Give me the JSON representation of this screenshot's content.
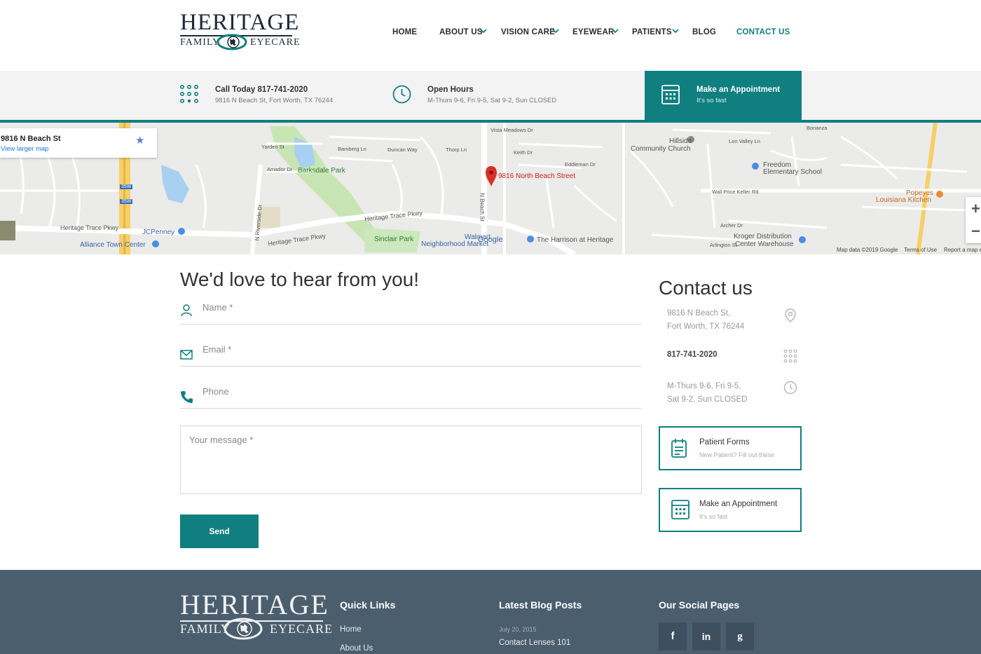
{
  "brand": {
    "logo_line1": "HERITAGE",
    "logo_family": "FAMILY",
    "logo_eyecare": "EYECARE",
    "accent_color": "#0f7f7f",
    "footer_color": "#4b5e6e"
  },
  "nav": {
    "items": [
      {
        "label": "HOME"
      },
      {
        "label": "ABOUT US"
      },
      {
        "label": "VISION CARE"
      },
      {
        "label": "EYEWEAR"
      },
      {
        "label": "PATIENTS"
      },
      {
        "label": "BLOG"
      },
      {
        "label": "CONTACT US"
      }
    ]
  },
  "infobar": {
    "call_title": "Call Today 817-741-2020",
    "call_sub": "9816 N Beach St, Fort Worth, TX 76244",
    "hours_title": "Open Hours",
    "hours_sub": "M-Thurs 9-6, Fri 9-5, Sat 9-2, Sun CLOSED",
    "appt_title": "Make an Appointment",
    "appt_sub": "It's so fast"
  },
  "map": {
    "card_address": "9816 N Beach St",
    "card_link": "View larger map",
    "pin_label": "9816 North Beach Street",
    "labels": {
      "barksdale": "Barksdale Park",
      "hillside1": "Hillside",
      "hillside2": "Community Church",
      "freedom1": "Freedom",
      "freedom2": "Elementary School",
      "popeyes1": "Popeyes",
      "popeyes2": "Louisiana Kitchen",
      "jcpenney": "JCPenney",
      "alliance": "Alliance Town Center",
      "heritage_trace": "Heritage Trace Pkwy",
      "heritage_trace2": "Heritage Trace Pkwy",
      "heritage_trace3": "Heritage Trace Pkwy",
      "sinclair": "Sinclair Park",
      "walmart1": "Walmart",
      "walmart2": "Neighborhood Market",
      "google": "Google",
      "harrison": "The Harrison at Heritage",
      "kroger1": "Kroger Distribution",
      "kroger2": "Center Warehouse",
      "nbeach": "N Beach St",
      "nriverside": "N Riverside Dr",
      "wallprice": "Wall Price Keller Rd",
      "bomberg": "Bamberg Ln",
      "yarden": "Yarden St",
      "amador": "Amador Dr",
      "duncan": "Duncan Way",
      "thorp": "Thorp Ln",
      "keith": "Keith Dr",
      "eddleman": "Eddleman Dr",
      "vista": "Vista Meadows Dr",
      "bonanza": "Bonanza",
      "lonvalley": "Lon Valley Ln",
      "archer": "Archer Dr",
      "arlington": "Arlington St",
      "i35w1": "35W",
      "i35w2": "35W"
    },
    "footer": {
      "data": "Map data ©2019 Google",
      "terms": "Terms of Use",
      "report": "Report a map error"
    }
  },
  "form": {
    "title": "We'd love to hear from you!",
    "name_placeholder": "Name *",
    "email_placeholder": "Email *",
    "phone_placeholder": "Phone",
    "message_placeholder": "Your message *",
    "send_label": "Send"
  },
  "contact": {
    "title": "Contact us",
    "address1": "9816 N Beach St,",
    "address2": "Fort Worth, TX 76244",
    "phone": "817-741-2020",
    "hours1": "M-Thurs 9-6, Fri 9-5,",
    "hours2": "Sat 9-2, Sun CLOSED",
    "forms_title": "Patient Forms",
    "forms_sub": "New Patient? Fill out these",
    "appt_title": "Make an Appointment",
    "appt_sub": "It's so fast"
  },
  "footer": {
    "quick_links_title": "Quick Links",
    "quick_links": [
      "Home",
      "About Us"
    ],
    "blog_title": "Latest Blog Posts",
    "blog_date": "July 20, 2015",
    "blog_post": "Contact Lenses 101",
    "social_title": "Our Social Pages",
    "social": [
      {
        "icon": "facebook-icon",
        "glyph": "f"
      },
      {
        "icon": "linkedin-icon",
        "glyph": "in"
      },
      {
        "icon": "google-plus-icon",
        "glyph": "g"
      }
    ]
  }
}
